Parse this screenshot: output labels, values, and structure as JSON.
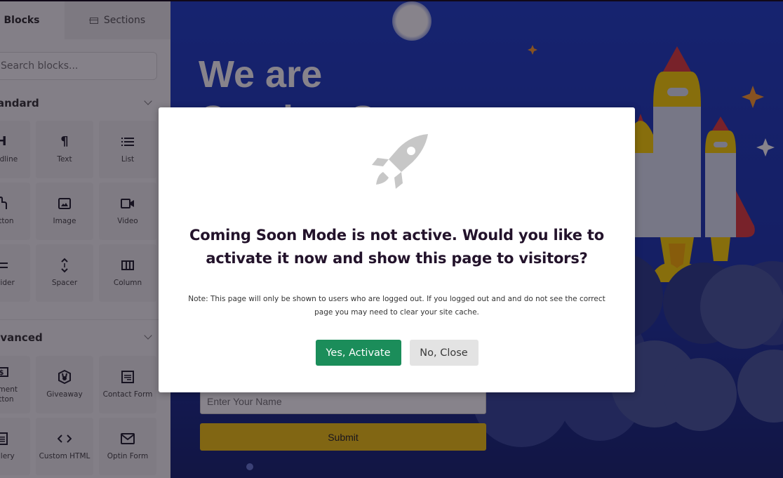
{
  "sidebar": {
    "tabs": [
      {
        "label": "Blocks",
        "active": true
      },
      {
        "label": "Sections",
        "icon": "sections-icon",
        "active": false
      }
    ],
    "search": {
      "placeholder": "Search blocks..."
    },
    "sections": [
      {
        "title": "Standard",
        "collapsed": false,
        "blocks": [
          {
            "label": "Headline",
            "icon": "headline-icon"
          },
          {
            "label": "Text",
            "icon": "paragraph-icon"
          },
          {
            "label": "List",
            "icon": "list-icon"
          },
          {
            "label": "Button",
            "icon": "button-pointer-icon"
          },
          {
            "label": "Image",
            "icon": "image-icon"
          },
          {
            "label": "Video",
            "icon": "video-icon"
          },
          {
            "label": "Divider",
            "icon": "divider-icon"
          },
          {
            "label": "Spacer",
            "icon": "spacer-icon"
          },
          {
            "label": "Column",
            "icon": "column-icon"
          }
        ]
      },
      {
        "title": "Advanced",
        "collapsed": false,
        "blocks": [
          {
            "label": "Payment Button",
            "icon": "payment-icon"
          },
          {
            "label": "Giveaway",
            "icon": "giveaway-icon"
          },
          {
            "label": "Contact Form",
            "icon": "contact-form-icon"
          },
          {
            "label": "Gallery",
            "icon": "gallery-icon"
          },
          {
            "label": "Custom HTML",
            "icon": "code-icon"
          },
          {
            "label": "Optin Form",
            "icon": "envelope-icon"
          }
        ]
      }
    ]
  },
  "canvas": {
    "hero_line1": "We are",
    "hero_line2": "Coming Soon",
    "name_input": {
      "placeholder": "Enter Your Name",
      "value": ""
    },
    "submit_label": "Submit",
    "colors": {
      "background": "#1d3fc7",
      "submit": "#f2c40f"
    }
  },
  "modal": {
    "icon": "rocket-icon",
    "title": "Coming Soon Mode is not active. Would you like to activate it now and show this page to visitors?",
    "note": "Note: This page will only be shown to users who are logged out. If you logged out and and do not see the correct page you may need to clear your site cache.",
    "confirm_label": "Yes, Activate",
    "cancel_label": "No, Close",
    "colors": {
      "confirm": "#1b8d5a",
      "cancel": "#e3e3e3"
    }
  }
}
